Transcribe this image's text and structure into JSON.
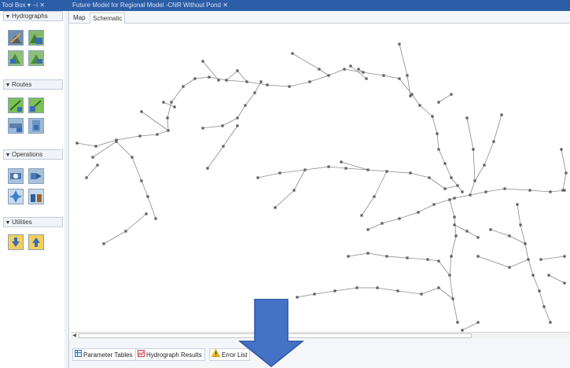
{
  "window": {
    "toolbox_title": "Tool Box ▾ ⊣ ✕",
    "document_title": "Future Model for Regional Model -CNR Without Pond ✕",
    "accent_color": "#2c5ea8"
  },
  "toolbox": {
    "sections": [
      {
        "label": "Hydrographs",
        "tools": [
          "hydrograph-tool-1-icon",
          "hydrograph-tool-2-icon",
          "hydrograph-tool-3-icon",
          "hydrograph-tool-4-icon"
        ]
      },
      {
        "label": "Routes",
        "tools": [
          "route-tool-1-icon",
          "route-tool-2-icon",
          "route-tool-3-icon",
          "route-tool-4-icon"
        ]
      },
      {
        "label": "Operations",
        "tools": [
          "operation-tool-1-icon",
          "operation-tool-2-icon",
          "operation-tool-3-icon",
          "operation-tool-4-icon"
        ]
      },
      {
        "label": "Utilities",
        "tools": [
          "utility-tool-1-icon",
          "utility-tool-2-icon"
        ]
      }
    ]
  },
  "tabs": {
    "map": "Map",
    "schematic": "Schematic",
    "active": "Schematic"
  },
  "bottom_tabs": {
    "parameter_tables": "Parameter Tables",
    "hydrograph_results": "Hydrograph Results",
    "error_list": "Error List"
  },
  "annotation": {
    "arrow_color": "#4472c4",
    "arrow_direction": "down"
  }
}
